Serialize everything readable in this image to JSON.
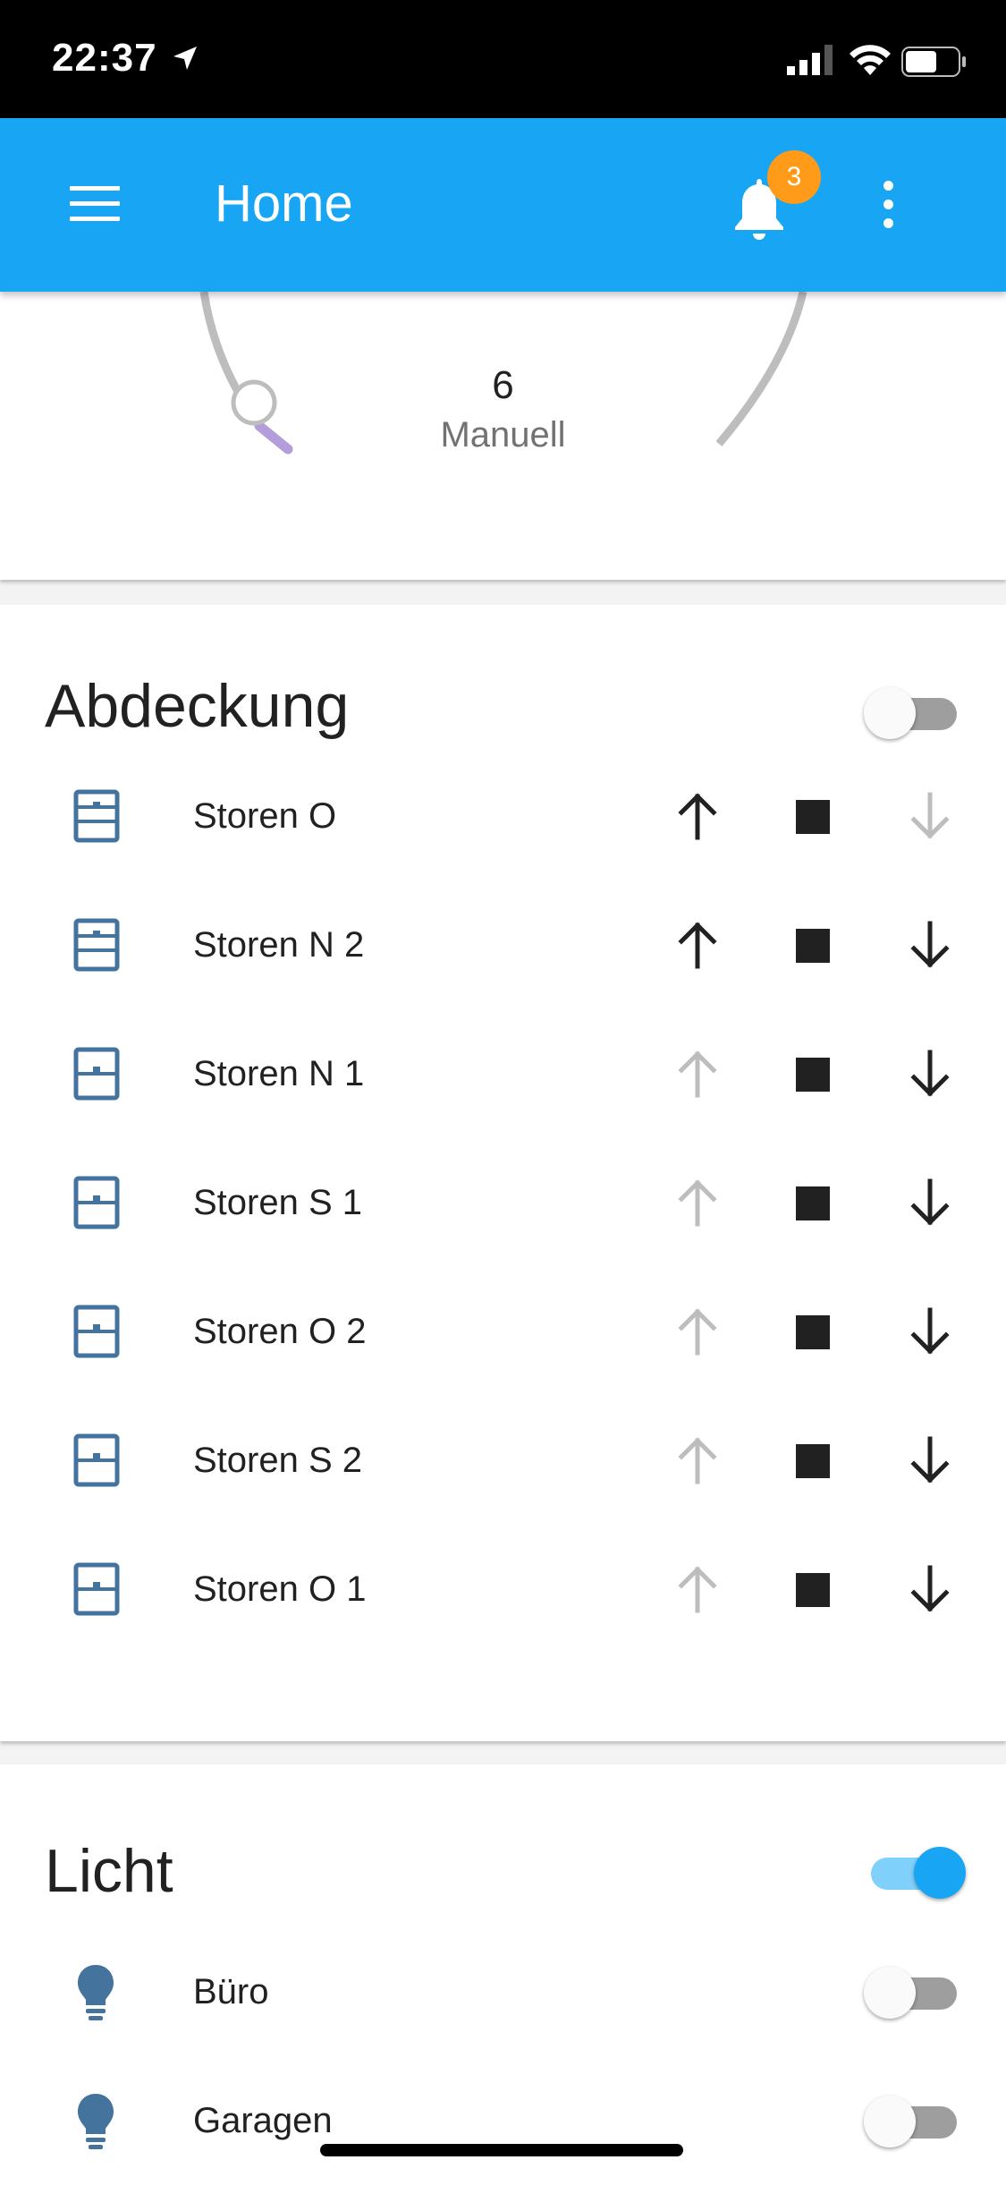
{
  "status_bar": {
    "time": "22:37"
  },
  "app_bar": {
    "title": "Home",
    "notification_count": "3",
    "colors": {
      "background": "#18a5f3",
      "badge": "#ff9b18"
    }
  },
  "thermostat_card": {
    "value": "6",
    "mode": "Manuell"
  },
  "cover_card": {
    "title": "Abdeckung",
    "toggle_on": false,
    "items": [
      {
        "label": "Storen O",
        "up_enabled": true,
        "down_enabled": false
      },
      {
        "label": "Storen N 2",
        "up_enabled": true,
        "down_enabled": true
      },
      {
        "label": "Storen N 1",
        "up_enabled": false,
        "down_enabled": true
      },
      {
        "label": "Storen S 1",
        "up_enabled": false,
        "down_enabled": true
      },
      {
        "label": "Storen O 2",
        "up_enabled": false,
        "down_enabled": true
      },
      {
        "label": "Storen S 2",
        "up_enabled": false,
        "down_enabled": true
      },
      {
        "label": "Storen O 1",
        "up_enabled": false,
        "down_enabled": true
      }
    ],
    "icons": {
      "item": "window-shutter-icon",
      "up": "arrow-up-icon",
      "stop": "stop-icon",
      "down": "arrow-down-icon"
    }
  },
  "light_card": {
    "title": "Licht",
    "toggle_on": true,
    "items": [
      {
        "label": "Büro",
        "on": false
      },
      {
        "label": "Garagen",
        "on": false
      }
    ],
    "icons": {
      "item": "lightbulb-icon"
    }
  }
}
